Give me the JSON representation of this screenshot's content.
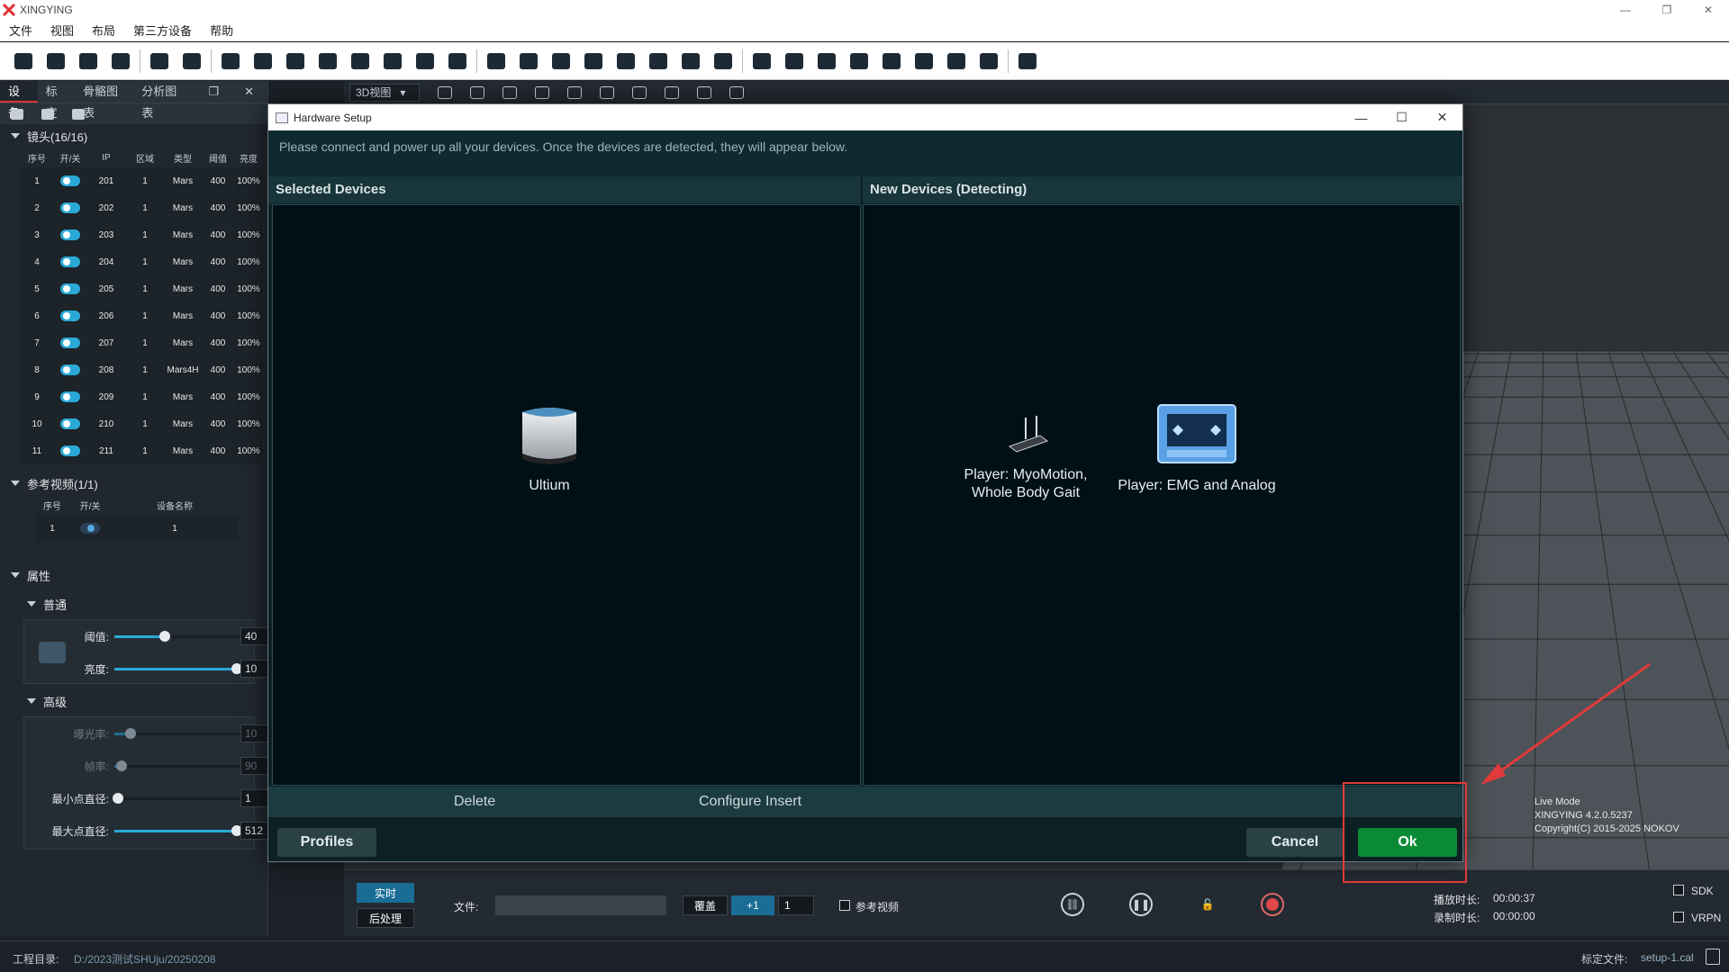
{
  "app": {
    "title": "XINGYING",
    "menu": [
      "文件",
      "视图",
      "布局",
      "第三方设备",
      "帮助"
    ]
  },
  "left_panel": {
    "tabs": [
      "设备",
      "标定",
      "骨骼图表",
      "分析图表"
    ],
    "cameras_section": "镜头(16/16)",
    "camera_columns": [
      "序号",
      "开/关",
      "IP",
      "区域",
      "类型",
      "阈值",
      "亮度"
    ],
    "cameras": [
      {
        "no": "1",
        "ip": "201",
        "zone": "1",
        "type": "Mars",
        "threshold": "400",
        "brightness": "100%"
      },
      {
        "no": "2",
        "ip": "202",
        "zone": "1",
        "type": "Mars",
        "threshold": "400",
        "brightness": "100%"
      },
      {
        "no": "3",
        "ip": "203",
        "zone": "1",
        "type": "Mars",
        "threshold": "400",
        "brightness": "100%"
      },
      {
        "no": "4",
        "ip": "204",
        "zone": "1",
        "type": "Mars",
        "threshold": "400",
        "brightness": "100%"
      },
      {
        "no": "5",
        "ip": "205",
        "zone": "1",
        "type": "Mars",
        "threshold": "400",
        "brightness": "100%"
      },
      {
        "no": "6",
        "ip": "206",
        "zone": "1",
        "type": "Mars",
        "threshold": "400",
        "brightness": "100%"
      },
      {
        "no": "7",
        "ip": "207",
        "zone": "1",
        "type": "Mars",
        "threshold": "400",
        "brightness": "100%"
      },
      {
        "no": "8",
        "ip": "208",
        "zone": "1",
        "type": "Mars4H",
        "threshold": "400",
        "brightness": "100%"
      },
      {
        "no": "9",
        "ip": "209",
        "zone": "1",
        "type": "Mars",
        "threshold": "400",
        "brightness": "100%"
      },
      {
        "no": "10",
        "ip": "210",
        "zone": "1",
        "type": "Mars",
        "threshold": "400",
        "brightness": "100%"
      },
      {
        "no": "11",
        "ip": "211",
        "zone": "1",
        "type": "Mars",
        "threshold": "400",
        "brightness": "100%"
      }
    ],
    "ref_video_section": "参考视频(1/1)",
    "ref_video_columns": [
      "序号",
      "开/关",
      "设备名称"
    ],
    "ref_videos": [
      {
        "no": "1",
        "name": "1"
      }
    ],
    "properties_section": "属性",
    "general_section": "普通",
    "threshold_label": "阈值:",
    "threshold_value": "40",
    "brightness_label": "亮度:",
    "brightness_value": "10",
    "advanced_section": "高级",
    "exposure_label": "曝光率:",
    "exposure_value": "10",
    "framerate_label": "帧率:",
    "framerate_value": "90",
    "min_dot_label": "最小点直径:",
    "min_dot_value": "1",
    "max_dot_label": "最大点直径:",
    "max_dot_value": "512"
  },
  "workspace": {
    "view_select": "3D视图",
    "live_info": [
      "Live Mode",
      "XINGYING 4.2.0.5237",
      "Copyright(C) 2015-2025 NOKOV"
    ]
  },
  "bottom_bar": {
    "live_btn": "实时",
    "post_btn": "后处理",
    "file_label": "文件:",
    "overwrite_btn": "覆盖",
    "increment_btn": "+1",
    "spin_value": "1",
    "ref_video_label": "参考视频",
    "play_time_label": "播放时长:",
    "play_time": "00:00:37",
    "rec_time_label": "录制时长:",
    "rec_time": "00:00:00",
    "sdk_label": "SDK",
    "vrpn_label": "VRPN"
  },
  "status_bar": {
    "project_label": "工程目录:",
    "project_path": "D:/2023测试SHUju/20250208",
    "cal_label": "标定文件:",
    "cal_file": "setup-1.cal"
  },
  "dialog": {
    "title": "Hardware Setup",
    "instructions": "Please connect and power up all your devices. Once the devices are detected, they will appear below.",
    "selected_header": "Selected Devices",
    "new_header": "New Devices (Detecting)",
    "selected_devices": [
      "Ultium"
    ],
    "new_devices": [
      "Player: MyoMotion, Whole Body Gait",
      "Player: EMG and Analog"
    ],
    "delete_label": "Delete",
    "configure_label": "Configure",
    "insert_label": "Insert",
    "profiles_btn": "Profiles",
    "cancel_btn": "Cancel",
    "ok_btn": "Ok"
  },
  "colors": {
    "ok_green": "#0b8a36",
    "accent_blue": "#2aa9d6",
    "annotation_red": "#e23a3a"
  }
}
